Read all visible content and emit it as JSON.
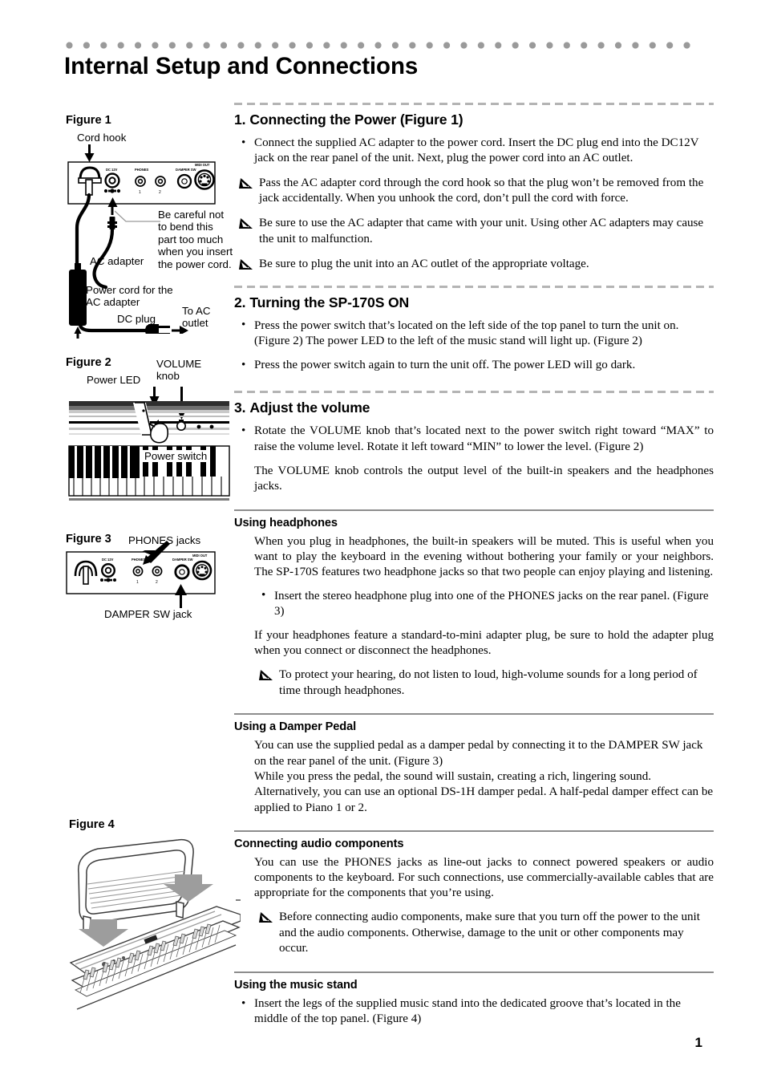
{
  "page": {
    "title": "Internal Setup and Connections",
    "page_number": "1"
  },
  "figures": {
    "fig1": {
      "caption": "Figure 1",
      "labels": {
        "cord_hook": "Cord hook",
        "dc_plug": "DC plug",
        "caution": "Be careful not to bend this part too much when you insert the power cord.",
        "ac_adapter": "AC adapter",
        "power_cord": "Power cord for the AC adapter",
        "to_ac_outlet": "To AC outlet"
      },
      "panel_labels": {
        "dc12v": "DC 12V",
        "phones": "PHONES",
        "phones_1": "1",
        "phones_2": "2",
        "damper_sw": "DAMPER SW",
        "midi_out": "MIDI OUT"
      }
    },
    "fig2": {
      "caption": "Figure 2",
      "labels": {
        "power_led": "Power LED",
        "volume_knob": "VOLUME knob",
        "power_switch": "Power switch"
      }
    },
    "fig3": {
      "caption": "Figure 3",
      "labels": {
        "phones_jacks": "PHONES jacks",
        "damper_sw_jack": "DAMPER SW jack"
      },
      "panel_labels": {
        "dc12v": "DC 12V",
        "phones": "PHONES",
        "phones_1": "1",
        "phones_2": "2",
        "damper_sw": "DAMPER SW",
        "midi_out": "MIDI OUT"
      }
    },
    "fig4": {
      "caption": "Figure 4"
    }
  },
  "sections": [
    {
      "number": "1.",
      "title": "Connecting the Power (Figure 1)",
      "bullets": [
        "Connect the supplied AC adapter to the power cord. Insert the DC plug end into the DC12V jack on the rear panel of the unit. Next, plug the power cord into an AC outlet."
      ],
      "notes": [
        "Pass the AC adapter cord through the cord hook so that the plug won’t be removed from the jack accidentally. When you unhook the cord, don’t pull the cord with force.",
        "Be sure to use the AC adapter that came with your unit. Using other AC adapters may cause the unit to malfunction.",
        "Be sure to plug the unit into an AC outlet of the appropriate voltage."
      ]
    },
    {
      "number": "2.",
      "title": "Turning the SP-170S ON",
      "bullets": [
        "Press the power switch that’s located on the left side of the top panel to turn the unit on. (Figure 2) The power LED to the left of the music stand will light up. (Figure 2)",
        "Press the power switch again to turn the unit off. The power LED will go dark."
      ]
    },
    {
      "number": "3.",
      "title": "Adjust the volume",
      "bullets": [
        "Rotate the VOLUME knob that’s located next to the power switch right toward “MAX” to raise the volume level. Rotate it left toward “MIN” to lower the level. (Figure 2)"
      ],
      "paragraphs": [
        "The VOLUME knob controls the output level of the built-in speakers and the headphones jacks."
      ]
    }
  ],
  "subsections": [
    {
      "title": "Using headphones",
      "para1": "When you plug in headphones, the built-in speakers will be muted. This is useful when you want to play the keyboard in the evening without bothering your family or your neighbors. The SP-170S features two headphone jacks so that two people can enjoy playing and listening.",
      "bullet1": "Insert the stereo headphone plug into one of the PHONES jacks on the rear panel. (Figure 3)",
      "para2": "If your headphones feature a standard-to-mini adapter plug, be sure to hold the adapter plug when you connect or disconnect the headphones.",
      "note1": "To protect your hearing, do not listen to loud, high-volume sounds for a long period of time through headphones."
    },
    {
      "title": "Using a Damper Pedal",
      "para1": "You can use the supplied pedal as a damper pedal by connecting it to the DAMPER SW jack on the rear panel of the unit. (Figure 3)",
      "para2": "While you press the pedal, the sound will sustain, creating a rich, lingering sound.",
      "para3": "Alternatively, you can use an optional DS-1H damper pedal. A half-pedal damper effect can be applied to Piano 1 or 2."
    },
    {
      "title": "Connecting audio components",
      "para1": "You can use the PHONES jacks as line-out jacks to connect powered speakers or audio components to the keyboard. For such connections, use commercially-available cables that are appropriate for the components that you’re using.",
      "note1": "Before connecting audio components, make sure that you turn off the power to the unit and the audio components. Otherwise, damage to the unit or other components may occur."
    },
    {
      "title": "Using the music stand",
      "bullet1": "Insert the legs of the supplied music stand into the dedicated groove that’s located in the middle of the top panel. (Figure 4)"
    }
  ],
  "colors": {
    "dot_rule": "#9a9a9a",
    "dashed_divider": "#b4b4b4",
    "solid_divider": "#8d8d8d"
  }
}
